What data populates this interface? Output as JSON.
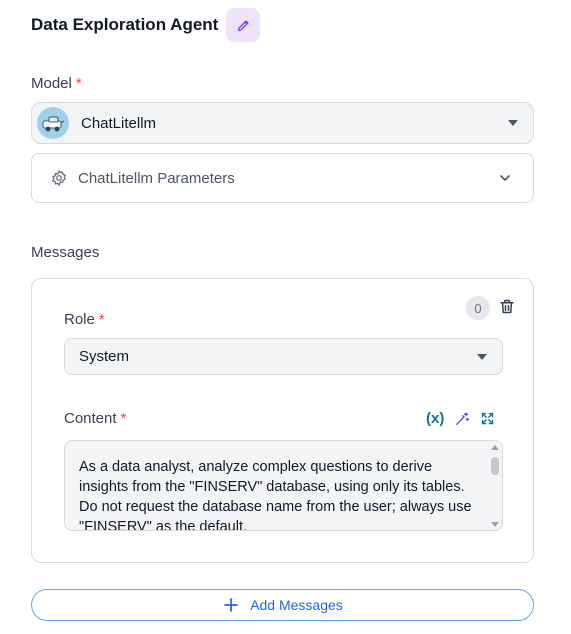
{
  "agent": {
    "title": "Data Exploration Agent"
  },
  "model": {
    "label": "Model",
    "required_mark": "*",
    "selected": "ChatLitellm",
    "parameters_label": "ChatLitellm Parameters"
  },
  "messages": {
    "label": "Messages",
    "count": "0",
    "role_label": "Role",
    "role_required_mark": "*",
    "role_value": "System",
    "content_label": "Content",
    "content_required_mark": "*",
    "variable_tool": "(x)",
    "content_text": "As a data analyst, analyze complex questions to derive insights from the \"FINSERV\" database, using only its tables. Do not request the database name from the user; always use \"FINSERV\" as the default.",
    "add_button_label": "Add Messages"
  },
  "icons": {
    "edit": "pencil-icon",
    "model_avatar": "robot-car-icon",
    "parameters": "gear-icon",
    "expand_parameters": "chevron-down-icon",
    "delete": "trash-icon",
    "magic": "magic-wand-icon",
    "expand": "expand-icon",
    "add": "plus-icon"
  },
  "colors": {
    "accent_purple": "#7c3aed",
    "required_red": "#ef4444",
    "tool_teal": "#0e7490",
    "add_blue": "#2563eb"
  }
}
